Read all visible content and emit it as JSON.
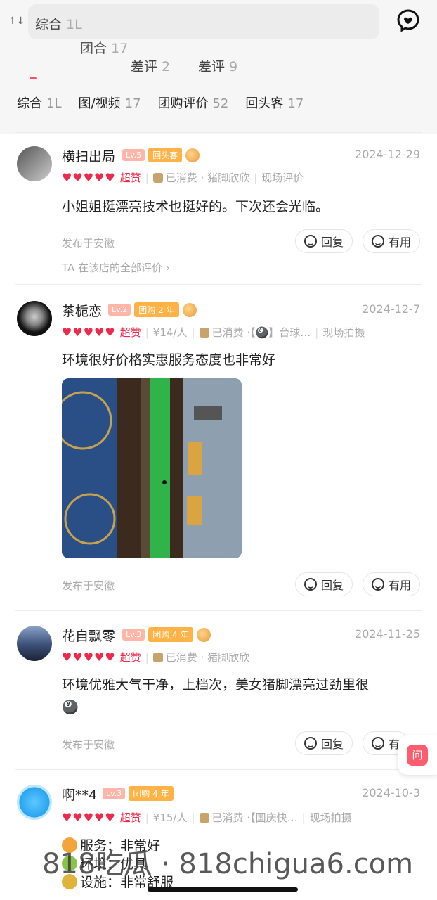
{
  "header": {
    "ghost_tab_1": "综合",
    "ghost_tab_1_count": "1L",
    "ghost_tab_2": "团合",
    "ghost_tab_2_count": "17",
    "ghost_bad_1": "差评",
    "ghost_bad_1_count": "2",
    "ghost_bad_2": "差评",
    "ghost_bad_2_count": "9",
    "sort_label": "1L"
  },
  "tabs": [
    {
      "label": "综合",
      "count": "1L"
    },
    {
      "label": "图/视频",
      "count": "17"
    },
    {
      "label": "团购评价",
      "count": "52"
    },
    {
      "label": "回头客",
      "count": "17"
    }
  ],
  "reviews": [
    {
      "name": "横扫出局",
      "level": "Lv.5",
      "tag": "回头客",
      "date": "2024-12-29",
      "hearts": "♥♥♥♥♥",
      "super": "超赞",
      "meta": "已消费 · 猪脚欣欣",
      "meta2": "现场评价",
      "content": "小姐姐挺漂亮技术也挺好的。下次还会光临。",
      "location": "发布于安徽",
      "all_link": "TA 在该店的全部评价 ›"
    },
    {
      "name": "茶栀恋",
      "level": "Lv.2",
      "tag": "团购 2 年",
      "date": "2024-12-7",
      "hearts": "♥♥♥♥♥",
      "super": "超赞",
      "price": "¥14/人",
      "meta": "已消费 ·【🎱】台球…",
      "meta2": "现场拍摄",
      "content": "环境很好价格实惠服务态度也非常好",
      "location": "发布于安徽"
    },
    {
      "name": "花自飘零",
      "level": "Lv.3",
      "tag": "团购 4 年",
      "date": "2024-11-25",
      "hearts": "♥♥♥♥♥",
      "super": "超赞",
      "meta": "已消费 · 猪脚欣欣",
      "content": "环境优雅大气干净，上档次，美女猪脚漂亮过劲里很",
      "content_emoji": "🎱",
      "location": "发布于安徽"
    },
    {
      "name": "啊**4",
      "level": "Lv.3",
      "tag": "团购 4 年",
      "date": "2024-10-3",
      "hearts": "♥♥♥♥♥",
      "super": "超赞",
      "price": "¥15/人",
      "meta": "已消费 ·【国庆快…",
      "meta2": "现场拍摄",
      "lines": [
        "服务：非常好",
        "环境：优具",
        "设施：非常舒服"
      ]
    }
  ],
  "buttons": {
    "reply": "回复",
    "useful": "有用",
    "useful_cut": "有"
  },
  "floating": {
    "ask": "问"
  },
  "watermark": "818吃瓜 · 818chigua6.com",
  "colors": {
    "accent": "#ee2a4a",
    "tag": "#ffb347",
    "level": "#ffb5a8"
  }
}
